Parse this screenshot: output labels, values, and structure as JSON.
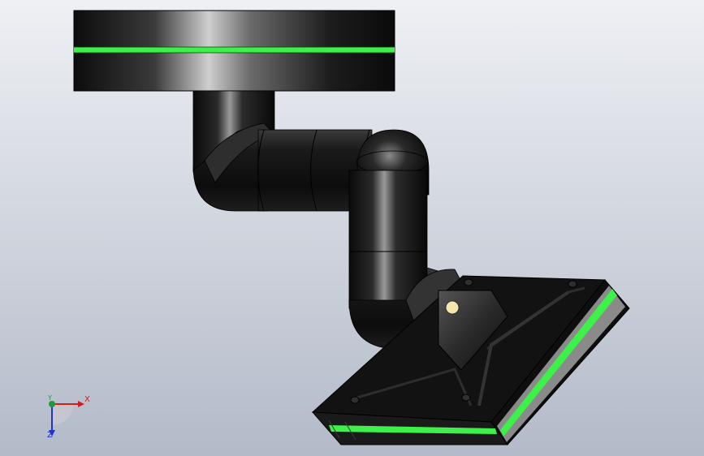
{
  "viewport": {
    "background_top": "#eef0f4",
    "background_bottom": "#b3bac8"
  },
  "model": {
    "body_color": "#111111",
    "accent_color": "#3df04a",
    "pad_edge_color": "#8a8a8a"
  },
  "triad": {
    "x_label": "X",
    "y_label": "Y",
    "z_label": "Z",
    "x_color": "#d21e1e",
    "y_color": "#1f9a3a",
    "z_color": "#2332c8"
  }
}
